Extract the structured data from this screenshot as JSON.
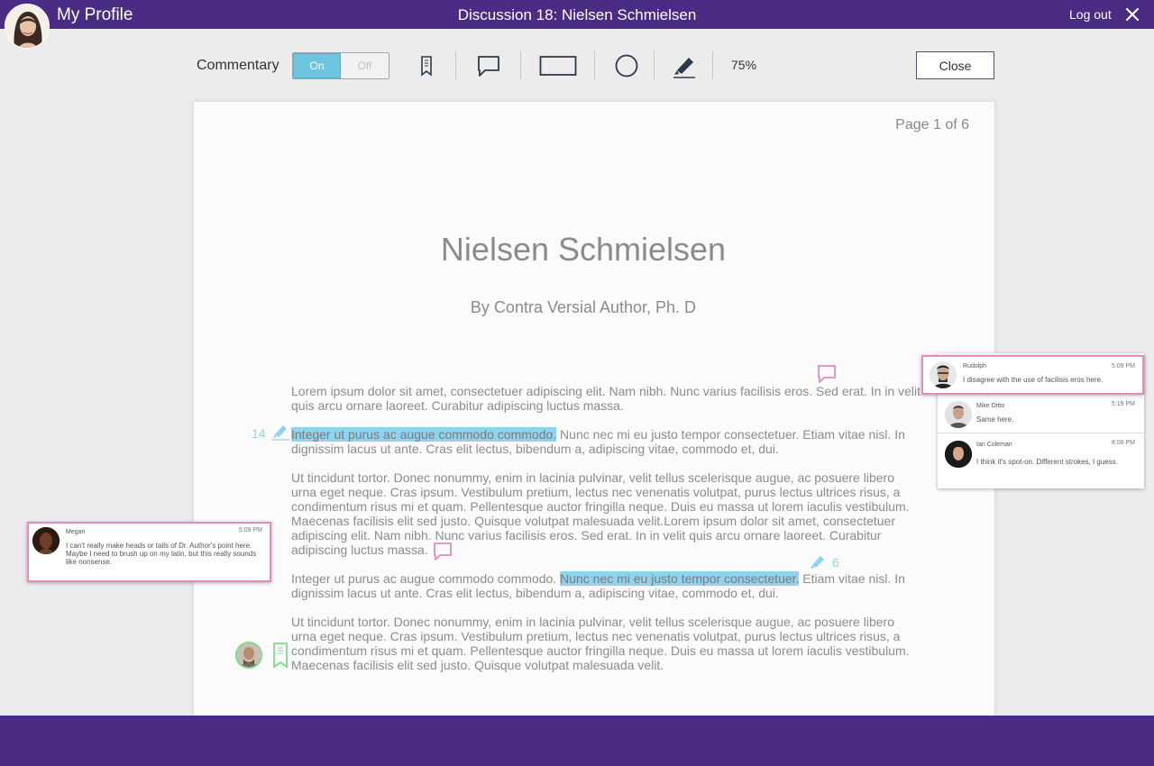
{
  "header": {
    "profile_label": "My Profile",
    "discussion_title": "Discussion 18: Nielsen Schmielsen",
    "logout_label": "Log out"
  },
  "toolbar": {
    "commentary_label": "Commentary",
    "toggle_on": "On",
    "toggle_off": "Off",
    "zoom": "75%",
    "close_label": "Close",
    "tools": [
      "bookmark-icon",
      "comment-icon",
      "rectangle-icon",
      "circle-icon",
      "highlighter-icon"
    ]
  },
  "document": {
    "page_indicator": "Page 1 of 6",
    "title": "Nielsen Schmielsen",
    "author": "By Contra Versial Author, Ph. D",
    "p1": "Lorem ipsum dolor sit amet, consectetuer adipiscing elit. Nam nibh. Nunc varius facilisis eros. Sed erat. In in velit quis arcu ornare laoreet. Curabitur adipiscing luctus massa.",
    "p2_highlight": "Integer ut purus ac augue commodo commodo.",
    "p2_rest": " Nunc nec mi eu justo tempor consectetuer. Etiam vitae nisl. In dignissim lacus ut ante. Cras elit lectus, bibendum a, adipiscing vitae, commodo et, dui.",
    "p3": "Ut tincidunt tortor. Donec nonummy, enim in lacinia pulvinar, velit tellus scelerisque augue, ac posuere libero urna eget neque. Cras ipsum. Vestibulum pretium, lectus nec venenatis volutpat, purus lectus ultrices risus, a condimentum risus mi et quam. Pellentesque auctor fringilla neque. Duis eu massa ut lorem iaculis vestibulum. Maecenas facilisis elit sed justo. Quisque volutpat malesuada velit.Lorem ipsum dolor sit amet, consectetuer adipiscing elit. Nam nibh. Nunc varius facilisis eros. Sed erat. In in velit quis arcu ornare laoreet. Curabitur adipiscing luctus massa.",
    "p4_start": "Integer ut purus ac augue commodo commodo. ",
    "p4_highlight": "Nunc nec mi eu justo tempor consectetuer.",
    "p4_rest": " Etiam vitae nisl. In dignissim lacus ut ante. Cras elit lectus, bibendum a, adipiscing vitae, commodo et, dui.",
    "p5": "Ut tincidunt tortor. Donec nonummy, enim in lacinia pulvinar, velit tellus scelerisque augue, ac posuere libero urna eget neque. Cras ipsum. Vestibulum pretium, lectus nec venenatis volutpat, purus lectus ultrices risus, a condimentum risus mi et quam. Pellentesque auctor fringilla neque. Duis eu massa ut lorem iaculis vestibulum. Maecenas facilisis elit sed justo. Quisque volutpat malesuada velit."
  },
  "markers": {
    "highlight_count_1": "14",
    "highlight_count_2": "6"
  },
  "comments": {
    "megan": {
      "name": "Megan",
      "time": "5:09 PM",
      "text": "I can't really make heads or tails of Dr. Author's point here. Maybe I need to brush up on my latin, but this really sounds like nonsense."
    },
    "thread": [
      {
        "name": "Rudolph",
        "time": "5:09 PM",
        "text": "I disagree with the use of facilisis eros here."
      },
      {
        "name": "Mike Ditto",
        "time": "5:19 PM",
        "text": "Same here."
      },
      {
        "name": "Ian Coleman",
        "time": "8:08 PM",
        "text": "I think it's spot-on. Different strokes, I guess."
      }
    ]
  },
  "colors": {
    "brand_purple": "#4b2c84",
    "highlight_blue": "#8fd3ef",
    "comment_pink": "#e48bc0",
    "bookmark_green": "#7ddc8a"
  }
}
